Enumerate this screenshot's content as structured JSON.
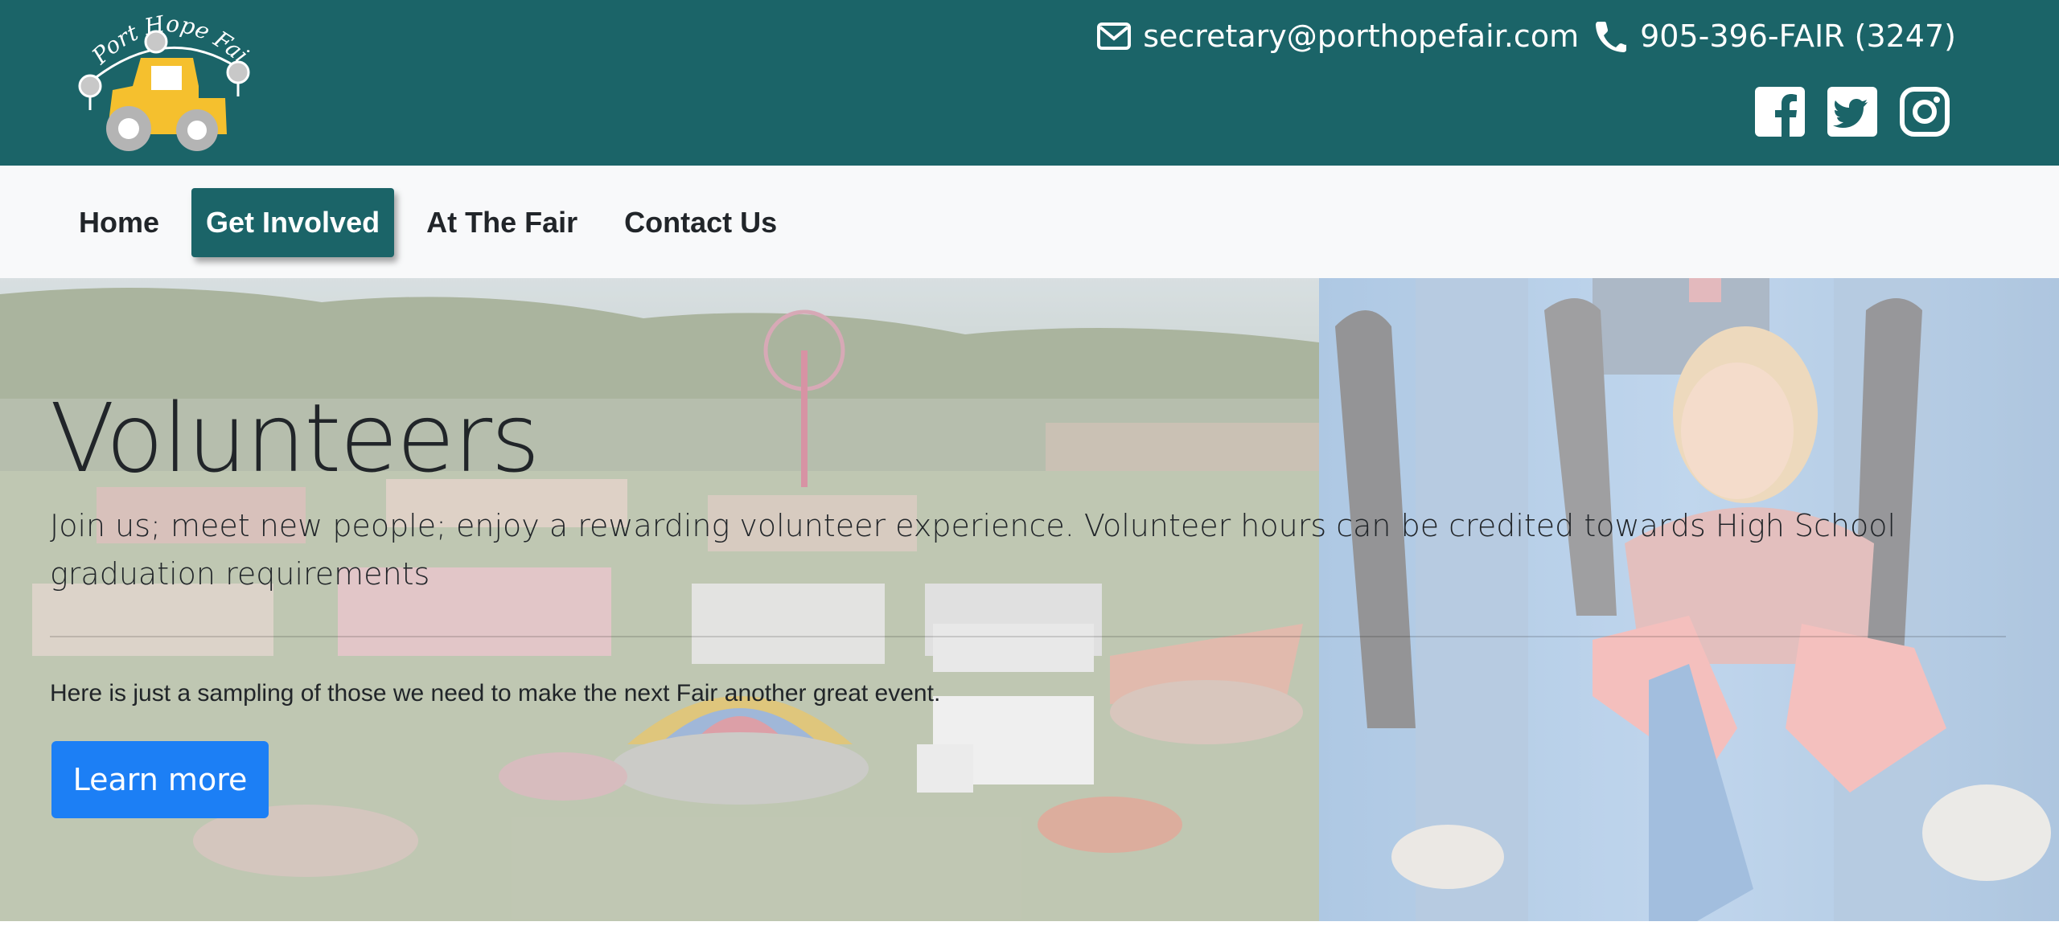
{
  "brand": {
    "logo_text": "Port Hope Fair"
  },
  "contact": {
    "email": "secretary@porthopefair.com",
    "email_icon": "envelope-icon",
    "phone": "905-396-FAIR (3247)",
    "phone_icon": "phone-icon"
  },
  "social": [
    {
      "name": "facebook-icon"
    },
    {
      "name": "twitter-icon"
    },
    {
      "name": "instagram-icon"
    }
  ],
  "nav": {
    "items": [
      {
        "label": "Home",
        "active": false
      },
      {
        "label": "Get Involved",
        "active": true
      },
      {
        "label": "At The Fair",
        "active": false
      },
      {
        "label": "Contact Us",
        "active": false
      }
    ]
  },
  "hero": {
    "title": "Volunteers",
    "lead": "Join us; meet new people; enjoy a rewarding volunteer experience. Volunteer hours can be credited towards High School graduation requirements",
    "text": "Here is just a sampling of those we need to make the next Fair another great event.",
    "button_label": "Learn more"
  },
  "colors": {
    "header_bg": "#1b6468",
    "nav_bg": "#f8f9fa",
    "active_nav_bg": "#1b6468",
    "button_bg": "#1c7ff5",
    "logo_tractor": "#f5c02e"
  }
}
